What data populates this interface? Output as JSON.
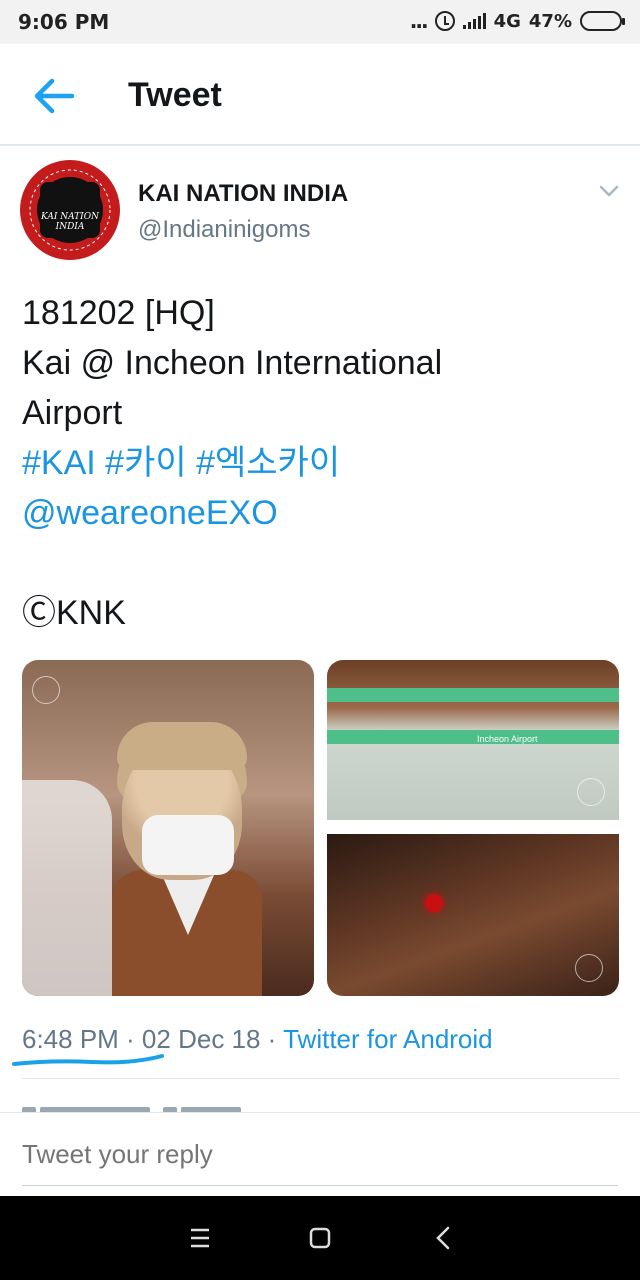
{
  "status_bar": {
    "time": "9:06 PM",
    "dots": "...",
    "network": "4G",
    "battery": "47%",
    "icons": [
      "alarm-icon",
      "signal-icon",
      "battery-icon"
    ]
  },
  "header": {
    "title": "Tweet",
    "back_icon": "arrow-left-icon"
  },
  "tweet": {
    "author": {
      "display_name": "KAI NATION INDIA",
      "handle": "@Indianinigoms",
      "avatar_text": "KAI NATION INDIA"
    },
    "lines": [
      "181202 [HQ]",
      "Kai @ Incheon International",
      "Airport"
    ],
    "hashtags": "#KAI #카이 #엑소카이",
    "mention": "@weareoneEXO",
    "credit": "ⒸKNK",
    "photo_sign": "Incheon Airport",
    "time": "6:48 PM · 02 Dec 18 · ",
    "source": "Twitter for Android"
  },
  "reply": {
    "placeholder": "Tweet your reply"
  },
  "colors": {
    "link": "#1b95e0",
    "secondary_text": "#657786",
    "primary_text": "#14171a",
    "battery_fill": "#f5b800"
  }
}
